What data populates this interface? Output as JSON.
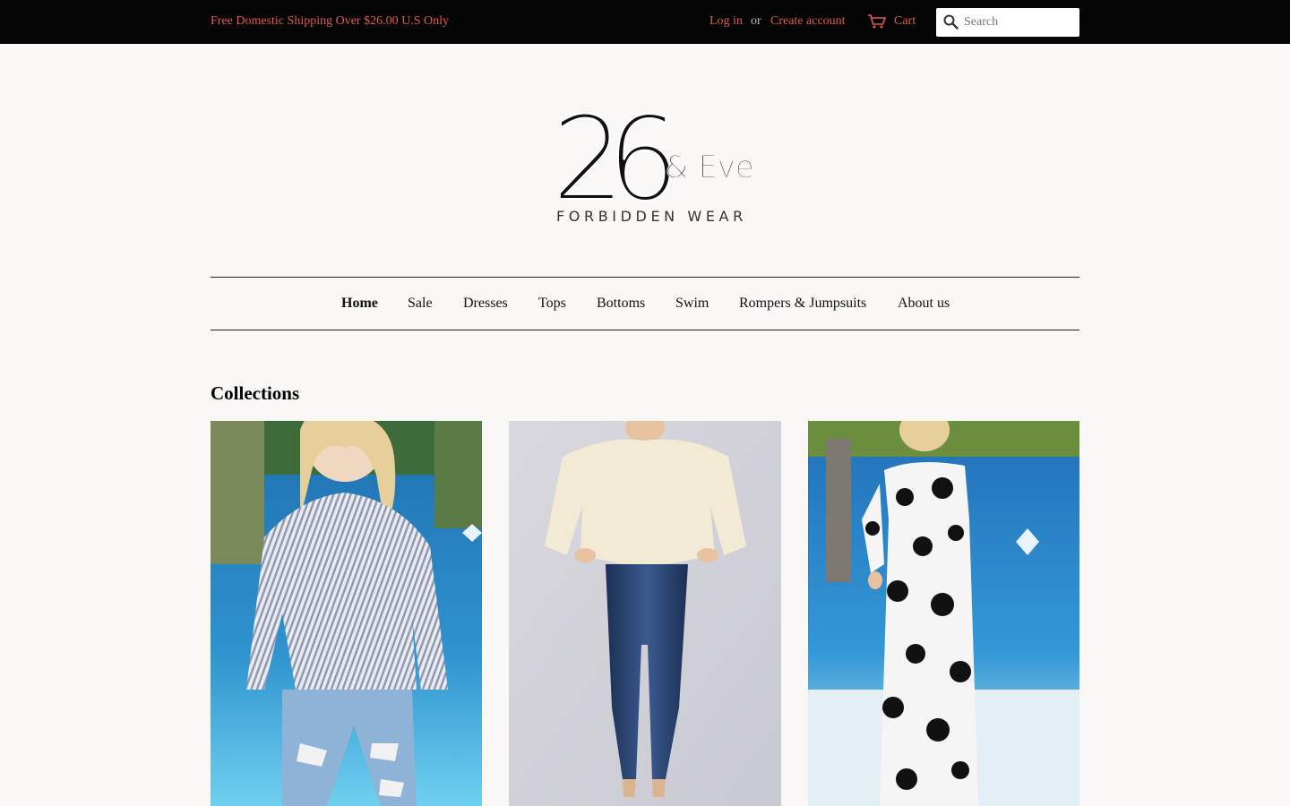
{
  "topbar": {
    "promo": "Free Domestic Shipping Over $26.00 U.S Only",
    "login": "Log in",
    "or": "or",
    "create_account": "Create account",
    "cart": "Cart",
    "search_placeholder": "Search",
    "accent_color": "#e35a52"
  },
  "logo": {
    "number": "26",
    "ampersand_name": "& Eve",
    "tagline": "FORBIDDEN WEAR"
  },
  "nav": {
    "items": [
      "Home",
      "Sale",
      "Dresses",
      "Tops",
      "Bottoms",
      "Swim",
      "Rompers & Jumpsuits",
      "About us"
    ],
    "active": "Home"
  },
  "collections": {
    "title": "Collections",
    "cards": [
      {
        "image": "model in striped wrap top and ripped jeans by pool"
      },
      {
        "image": "model in cream sweater and dark skinny jeans"
      },
      {
        "image": "model in polka dot off-shoulder maxi dress by pool"
      }
    ]
  }
}
